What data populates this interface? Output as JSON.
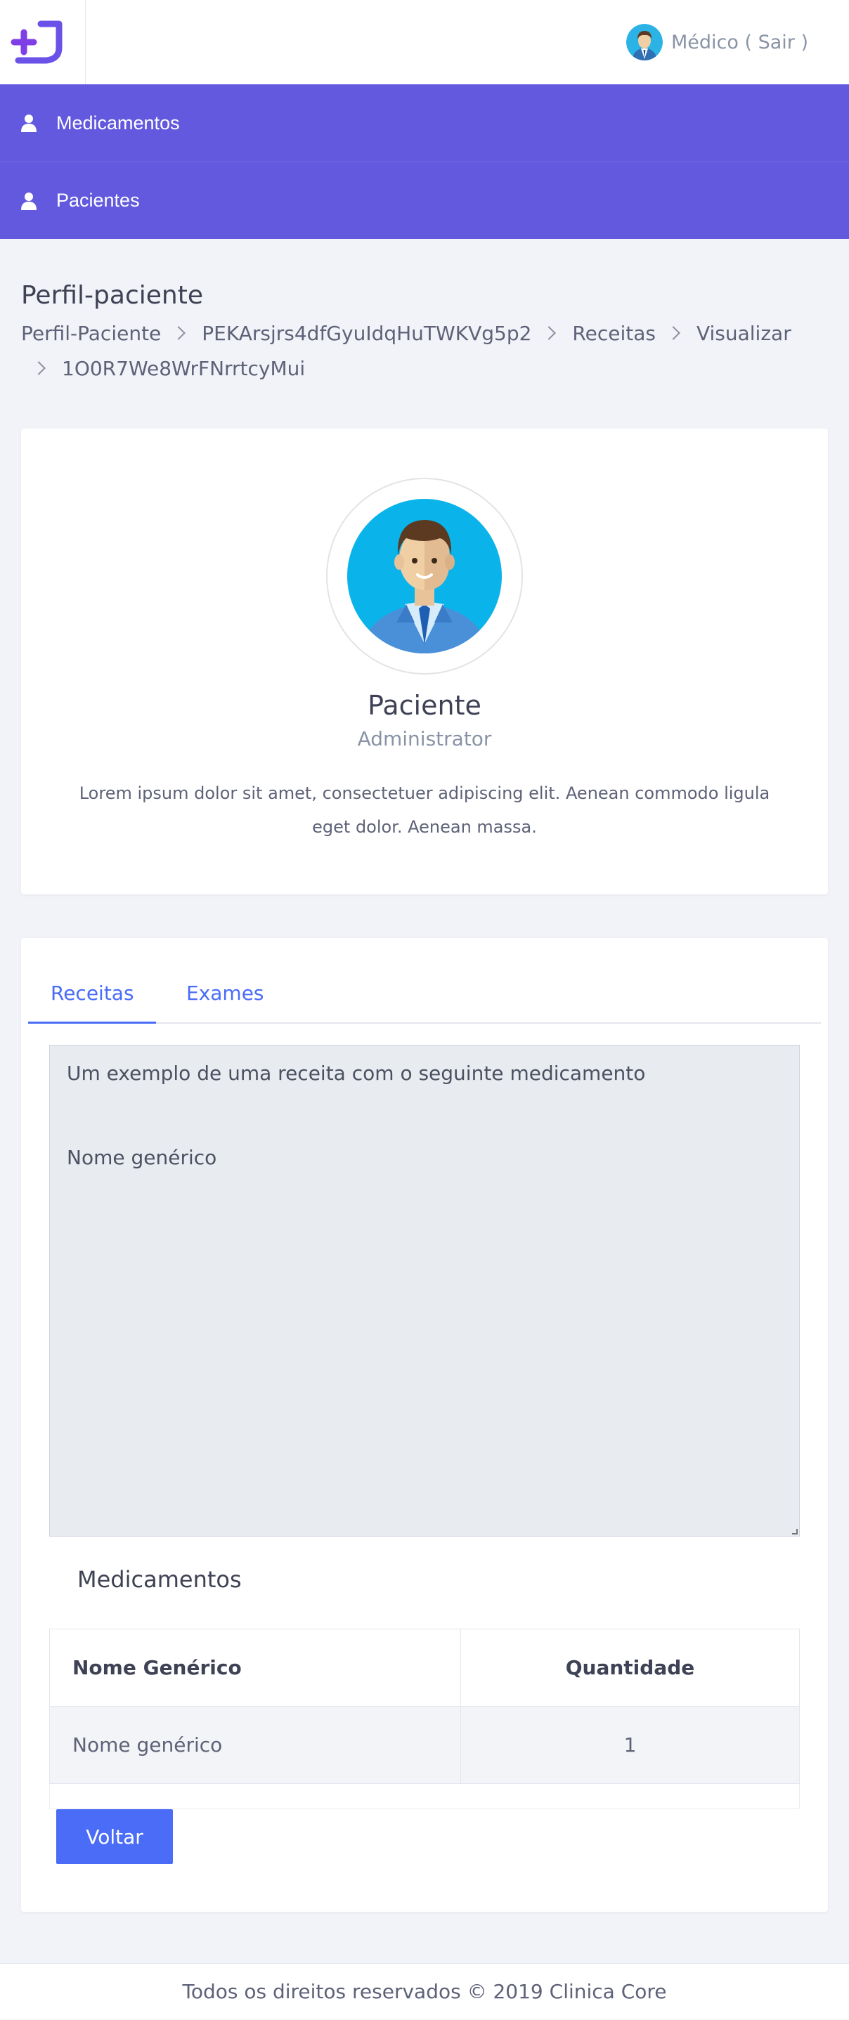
{
  "header": {
    "logo_icon": "plus-logo-icon",
    "user_label": "Médico ( Sair )",
    "user_avatar_icon": "doctor-avatar-icon"
  },
  "sidebar": {
    "items": [
      {
        "label": "Medicamentos",
        "icon": "user-icon"
      },
      {
        "label": "Pacientes",
        "icon": "user-icon"
      }
    ]
  },
  "page": {
    "title": "Perfil-paciente",
    "breadcrumb": [
      "Perfil-Paciente",
      "PEKArsjrs4dfGyuIdqHuTWKVg5p2",
      "Receitas",
      "Visualizar",
      "1O0R7We8WrFNrrtcyMui"
    ]
  },
  "profile": {
    "name": "Paciente",
    "role": "Administrator",
    "bio": "Lorem ipsum dolor sit amet, consectetuer adipiscing elit. Aenean commodo ligula eget dolor. Aenean massa."
  },
  "tabs": [
    {
      "label": "Receitas",
      "active": true
    },
    {
      "label": "Exames",
      "active": false
    }
  ],
  "prescription": {
    "line1": "Um exemplo de uma receita com o seguinte medicamento",
    "line2": "Nome genérico"
  },
  "medicamentos": {
    "heading": "Medicamentos",
    "columns": [
      "Nome Genérico",
      "Quantidade"
    ],
    "rows": [
      [
        "Nome genérico",
        "1"
      ]
    ]
  },
  "actions": {
    "back_label": "Voltar"
  },
  "footer": {
    "text": "Todos os direitos reservados © 2019 Clinica Core"
  },
  "colors": {
    "menu": "#6259de",
    "accent": "#4a6cf7",
    "background": "#f2f3f8"
  }
}
